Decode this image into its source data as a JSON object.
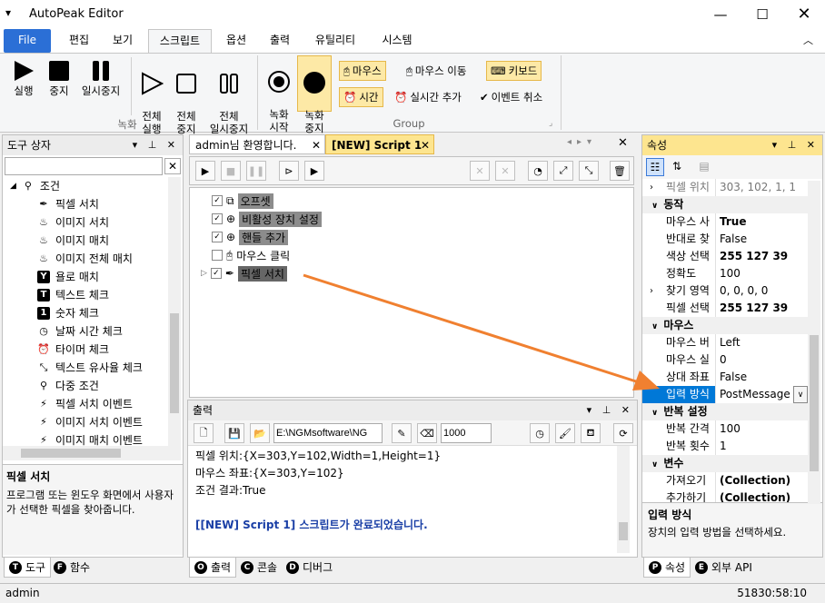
{
  "app": {
    "title": "AutoPeak Editor"
  },
  "ribbon_tabs": [
    "File",
    "편집",
    "보기",
    "스크립트",
    "옵션",
    "출력",
    "유틸리티",
    "시스템"
  ],
  "ribbon": {
    "record_group": {
      "label": "녹화",
      "buttons": [
        "실행",
        "중지",
        "일시중지",
        "전체\n실행",
        "전체\n중지",
        "전체\n일시중지"
      ]
    },
    "group2": {
      "label": "Group",
      "buttons": [
        "녹화\n시작",
        "녹화\n중지"
      ],
      "small": [
        "마우스",
        "마우스 이동",
        "키보드",
        "시간",
        "실시간 추가",
        "이벤트 취소"
      ]
    }
  },
  "toolbox": {
    "title": "도구 상자",
    "search_placeholder": "",
    "root": "조건",
    "items": [
      "픽셀 서치",
      "이미지 서치",
      "이미지 매치",
      "이미지 전체 매치",
      "욜로 매치",
      "텍스트 체크",
      "숫자 체크",
      "날짜 시간 체크",
      "타이머 체크",
      "텍스트 유사율 체크",
      "다중 조건",
      "픽셀 서치 이벤트",
      "이미지 서치 이벤트",
      "이미지 매치 이벤트"
    ],
    "desc_title": "픽셀 서치",
    "desc_text": "프로그램 또는 윈도우 화면에서 사용자가 선택한 픽셀을 찾아줍니다.",
    "bottom_tabs": [
      "도구",
      "함수"
    ]
  },
  "doc_tabs": [
    "admin님 환영합니다.",
    "[NEW] Script 1"
  ],
  "script": {
    "items": [
      {
        "label": "오프셋",
        "checked": true
      },
      {
        "label": "비활성 장치 설정",
        "checked": true
      },
      {
        "label": "핸들 추가",
        "checked": true
      },
      {
        "label": "마우스 클릭",
        "checked": false
      },
      {
        "label": "픽셀 서치",
        "checked": true
      }
    ]
  },
  "output": {
    "title": "출력",
    "path": "E:\\NGMsoftware\\NG",
    "number": "1000",
    "lines": [
      "픽셀 위치:{X=303,Y=102,Width=1,Height=1}",
      "마우스 좌표:{X=303,Y=102}",
      "조건 결과:True",
      "",
      "[[NEW] Script 1] 스크립트가 완료되었습니다."
    ],
    "bottom_tabs": [
      "출력",
      "콘솔",
      "디버그"
    ]
  },
  "properties": {
    "title": "속성",
    "rows": [
      {
        "type": "row",
        "k": "픽셀 위치",
        "v": "303, 102, 1, 1",
        "expand": true,
        "gray": true
      },
      {
        "type": "cat",
        "k": "동작"
      },
      {
        "type": "row",
        "k": "마우스 사",
        "v": "True",
        "bold": true
      },
      {
        "type": "row",
        "k": "반대로 찾",
        "v": "False"
      },
      {
        "type": "row",
        "k": "색상 선택",
        "v": "255 127 39",
        "bold": true
      },
      {
        "type": "row",
        "k": "정확도",
        "v": "100"
      },
      {
        "type": "row",
        "k": "찾기 영역",
        "v": "0, 0, 0, 0",
        "expand": true
      },
      {
        "type": "row",
        "k": "픽셀 선택",
        "v": "255 127 39",
        "bold": true
      },
      {
        "type": "cat",
        "k": "마우스"
      },
      {
        "type": "row",
        "k": "마우스 버",
        "v": "Left"
      },
      {
        "type": "row",
        "k": "마우스 실",
        "v": "0"
      },
      {
        "type": "row",
        "k": "상대 좌표",
        "v": "False"
      },
      {
        "type": "row",
        "k": "입력 방식",
        "v": "PostMessage",
        "selected": true
      },
      {
        "type": "cat",
        "k": "반복 설정"
      },
      {
        "type": "row",
        "k": "반복 간격",
        "v": "100"
      },
      {
        "type": "row",
        "k": "반복 횟수",
        "v": "1"
      },
      {
        "type": "cat",
        "k": "변수"
      },
      {
        "type": "row",
        "k": "가져오기",
        "v": "(Collection)",
        "bold": true
      },
      {
        "type": "row",
        "k": "추가하기",
        "v": "(Collection)",
        "bold": true
      }
    ],
    "desc_title": "입력 방식",
    "desc_text": "장치의 입력 방법을 선택하세요.",
    "bottom_tabs": [
      "속성",
      "외부 API"
    ]
  },
  "status": {
    "left": "admin",
    "right": "51830:58:10"
  },
  "colors": {
    "accent": "#2b6fd6",
    "highlight": "#fde58f",
    "arrow": "#f08030",
    "selected": "#0078d7"
  }
}
